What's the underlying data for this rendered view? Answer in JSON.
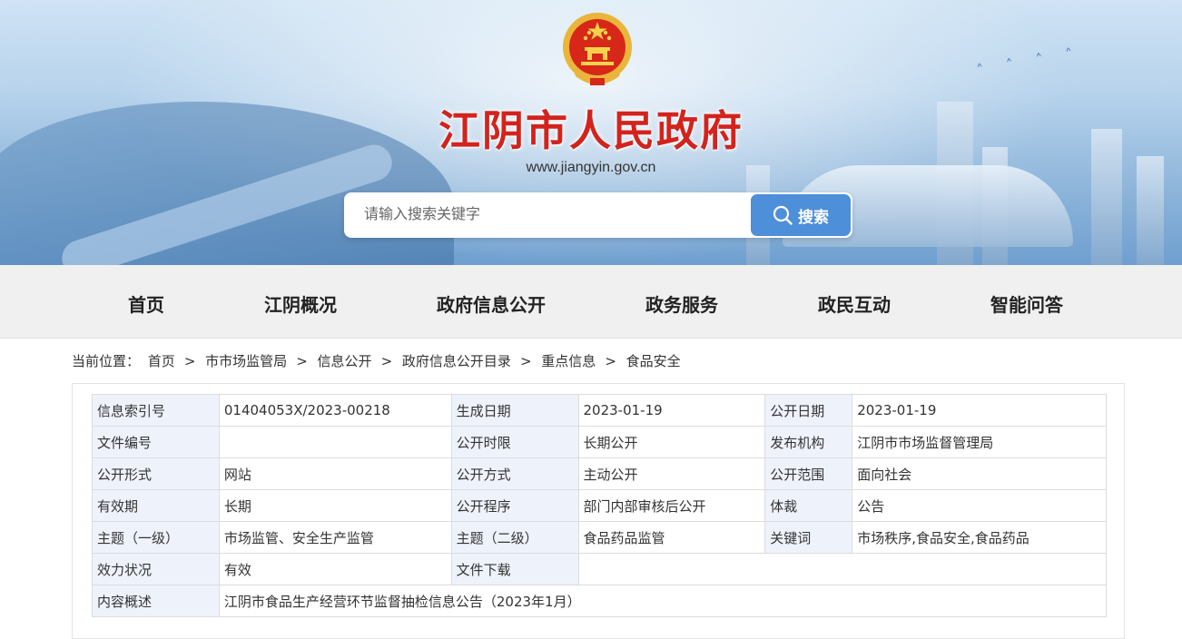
{
  "header": {
    "site_title": "江阴市人民政府",
    "site_url": "www.jiangyin.gov.cn",
    "search_placeholder": "请输入搜索关键字",
    "search_button": "搜索"
  },
  "nav": {
    "items": [
      "首页",
      "江阴概况",
      "政府信息公开",
      "政务服务",
      "政民互动",
      "智能问答"
    ]
  },
  "breadcrumb": {
    "prefix": "当前位置：",
    "items": [
      "首页",
      "市市场监管局",
      "信息公开",
      "政府信息公开目录",
      "重点信息",
      "食品安全"
    ],
    "separator": ">"
  },
  "info_table": {
    "rows": [
      [
        {
          "k": "信息索引号",
          "v": "01404053X/2023-00218"
        },
        {
          "k": "生成日期",
          "v": "2023-01-19"
        },
        {
          "k": "公开日期",
          "v": "2023-01-19"
        }
      ],
      [
        {
          "k": "文件编号",
          "v": ""
        },
        {
          "k": "公开时限",
          "v": "长期公开"
        },
        {
          "k": "发布机构",
          "v": "江阴市市场监督管理局"
        }
      ],
      [
        {
          "k": "公开形式",
          "v": "网站"
        },
        {
          "k": "公开方式",
          "v": "主动公开"
        },
        {
          "k": "公开范围",
          "v": "面向社会"
        }
      ],
      [
        {
          "k": "有效期",
          "v": "长期"
        },
        {
          "k": "公开程序",
          "v": "部门内部审核后公开"
        },
        {
          "k": "体裁",
          "v": "公告"
        }
      ],
      [
        {
          "k": "主题（一级）",
          "v": "市场监管、安全生产监管"
        },
        {
          "k": "主题（二级）",
          "v": "食品药品监管"
        },
        {
          "k": "关键词",
          "v": "市场秩序,食品安全,食品药品"
        }
      ]
    ],
    "validity_label": "效力状况",
    "validity_value": "有效",
    "download_label": "文件下载",
    "summary_label": "内容概述",
    "summary_value": "江阴市食品生产经营环节监督抽检信息公告（2023年1月）"
  },
  "colors": {
    "title_red": "#d3231d",
    "search_button_blue": "#4d8fd8",
    "nav_bg": "#f0f0f0",
    "table_label_bg": "#eef3fb"
  },
  "icons": [
    "national-emblem",
    "search-icon"
  ]
}
